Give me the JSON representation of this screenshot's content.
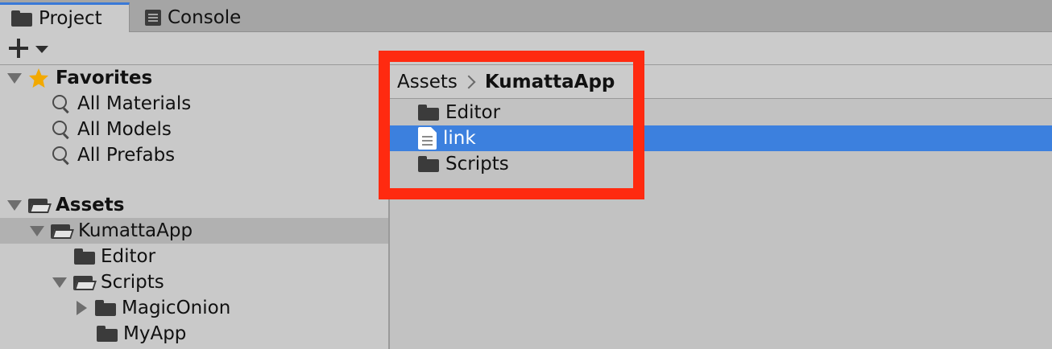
{
  "tabs": [
    {
      "label": "Project",
      "icon": "folder-icon",
      "active": true
    },
    {
      "label": "Console",
      "icon": "console-icon",
      "active": false
    }
  ],
  "toolbar": {
    "add_icon": "plus-icon",
    "dropdown_icon": "caret-down-icon"
  },
  "tree": {
    "favorites": {
      "label": "Favorites",
      "icon": "star-icon",
      "items": [
        "All Materials",
        "All Models",
        "All Prefabs"
      ]
    },
    "assets": {
      "label": "Assets",
      "kumatta": "KumattaApp",
      "editor": "Editor",
      "scripts": "Scripts",
      "magiconion": "MagicOnion",
      "myapp": "MyApp"
    },
    "selected": "KumattaApp"
  },
  "breadcrumb": {
    "root": "Assets",
    "current": "KumattaApp"
  },
  "files": [
    {
      "name": "Editor",
      "type": "folder",
      "selected": false
    },
    {
      "name": "link",
      "type": "document",
      "selected": true
    },
    {
      "name": "Scripts",
      "type": "folder",
      "selected": false
    }
  ],
  "colors": {
    "selection": "#3c80de",
    "tree_selection": "#b1b1b1",
    "highlight_box": "#ff2a10",
    "star": "#f2a900"
  }
}
